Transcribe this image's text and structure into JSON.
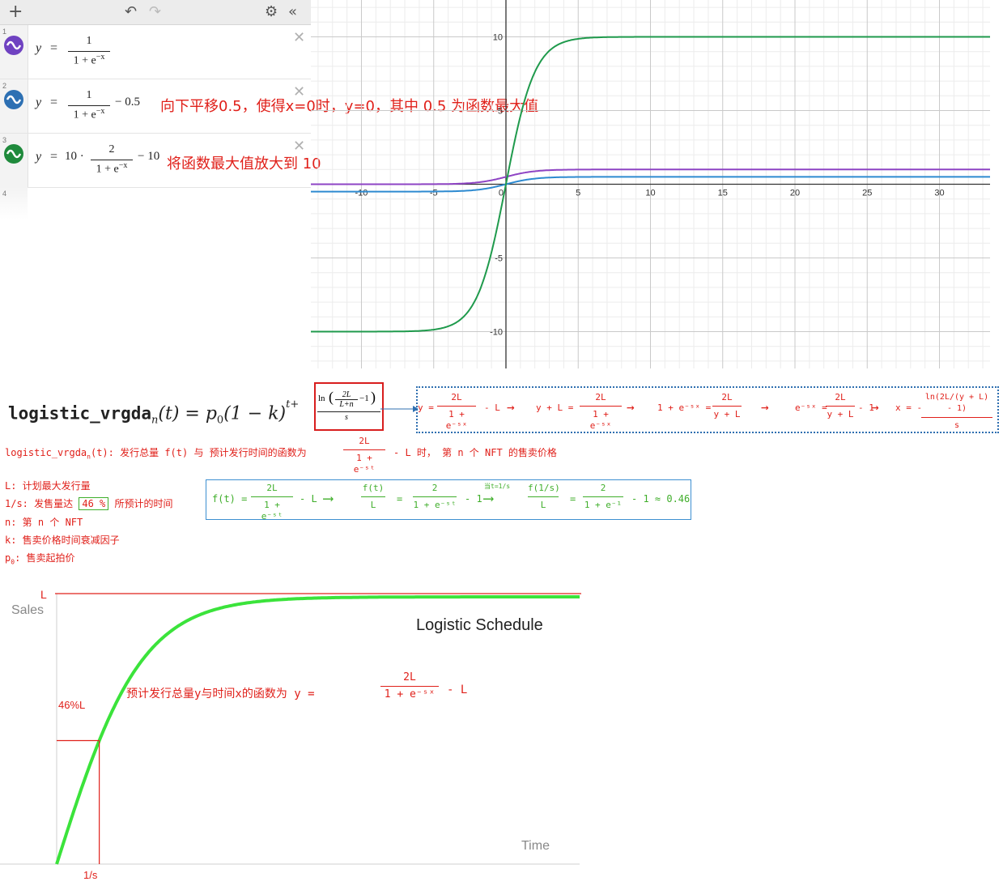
{
  "toolbar": {
    "add_icon": "plus-icon",
    "undo_icon": "undo-icon",
    "redo_icon": "redo-icon",
    "settings_icon": "gear-icon",
    "collapse_icon": "double-chevron-left-icon"
  },
  "expressions": [
    {
      "index": "1",
      "color": "#6f42c1",
      "lhs": "y",
      "eq": "=",
      "num": "1",
      "den": "1 + e",
      "den_exp": "−x",
      "tail": "",
      "note": ""
    },
    {
      "index": "2",
      "color": "#2d70b3",
      "lhs": "y",
      "eq": "=",
      "num": "1",
      "den": "1 + e",
      "den_exp": "−x",
      "tail": "− 0.5",
      "note": "向下平移0.5，使得x=0时，y=0，其中 0.5 为函数最大值"
    },
    {
      "index": "3",
      "color": "#1f8a3c",
      "lhs": "y",
      "eq": "=",
      "prefix": "10 ·",
      "num": "2",
      "den": "1 + e",
      "den_exp": "−x",
      "tail": "− 10",
      "note": "将函数最大值放大到 10"
    },
    {
      "index": "4"
    }
  ],
  "graph": {
    "x_ticks": [
      "-10",
      "-5",
      "0",
      "5",
      "10",
      "15",
      "20",
      "25",
      "30"
    ],
    "y_ticks": [
      "10",
      "5",
      "-5",
      "-10"
    ],
    "xlim": [
      -13.5,
      33.5
    ],
    "ylim": [
      -12.5,
      12.5
    ],
    "series_colors": {
      "purple": "#8e44c4",
      "blue": "#2d8ad0",
      "green": "#1f9a4c"
    }
  },
  "formula": {
    "name": "logistic_vrgda",
    "sub": "n",
    "rest": "(t) = p",
    "p_sub": "0",
    "tail": "(1 − k)",
    "exp_t": "t+",
    "ln_text": "ln",
    "inner_num": "2L",
    "inner_den": "L+n",
    "inner_tail": "−1",
    "s": "s"
  },
  "derivation": {
    "s1_lhs": "y =",
    "s1_num": "2L",
    "s1_den": "1 + e⁻ˢˣ",
    "s1_tail": "- L",
    "s2_lhs": "y + L =",
    "s2_num": "2L",
    "s2_den": "1 + e⁻ˢˣ",
    "s3_lhs": "1 + e⁻ˢˣ =",
    "s3_num": "2L",
    "s3_den": "y + L",
    "s4_lhs": "e⁻ˢˣ =",
    "s4_num": "2L",
    "s4_den": "y + L",
    "s4_tail": "- 1",
    "s5_lhs": "x = -",
    "s5_num": "ln(2L/(y + L) - 1)",
    "s5_den": "s"
  },
  "notes": {
    "line1_a": "logistic_vrgda",
    "line1_sub": "n",
    "line1_b": "(t): 发行总量 f(t) 与 预计发行时间的函数为",
    "line1_num": "2L",
    "line1_den": "1 + e⁻ˢᵗ",
    "line1_c": "- L 时， 第 n 个 NFT 的售卖价格",
    "L_line": "L:  计划最大发行量",
    "s_line_a": "1/s:  发售量达",
    "s_line_box": "46 %",
    "s_line_b": "所预计的时间",
    "n_line": "n:  第 n 个 NFT",
    "k_line": "k:  售卖价格时间衰减因子",
    "p_line": "p",
    "p_sub": "0",
    "p_line_b": ":  售卖起拍价"
  },
  "green_derivation": {
    "a_lhs": "f(t) =",
    "a_num": "2L",
    "a_den": "1 + e⁻ˢᵗ",
    "a_tail": "- L",
    "b_num1": "f(t)",
    "b_den1": "L",
    "b_eq": "=",
    "b_num2": "2",
    "b_den2": "1 + e⁻ˢᵗ",
    "b_tail": "- 1",
    "arrow_label": "当t=1/s",
    "c_num1": "f(1/s)",
    "c_den1": "L",
    "c_eq": "=",
    "c_num2": "2",
    "c_den2": "1 + e⁻¹",
    "c_tail": "- 1 ≈ 0.46"
  },
  "bottom_chart": {
    "title": "Logistic Schedule",
    "ylabel": "Sales",
    "xlabel": "Time",
    "L_label": "L",
    "pct_label": "46%L",
    "s_label": "1/s",
    "annotation_a": "预计发行总量y与时间x的函数为 y =",
    "annotation_num": "2L",
    "annotation_den": "1 + e⁻ˢˣ",
    "annotation_tail": "- L",
    "colors": {
      "curve": "#3be33b",
      "marker": "#e0201a"
    }
  }
}
